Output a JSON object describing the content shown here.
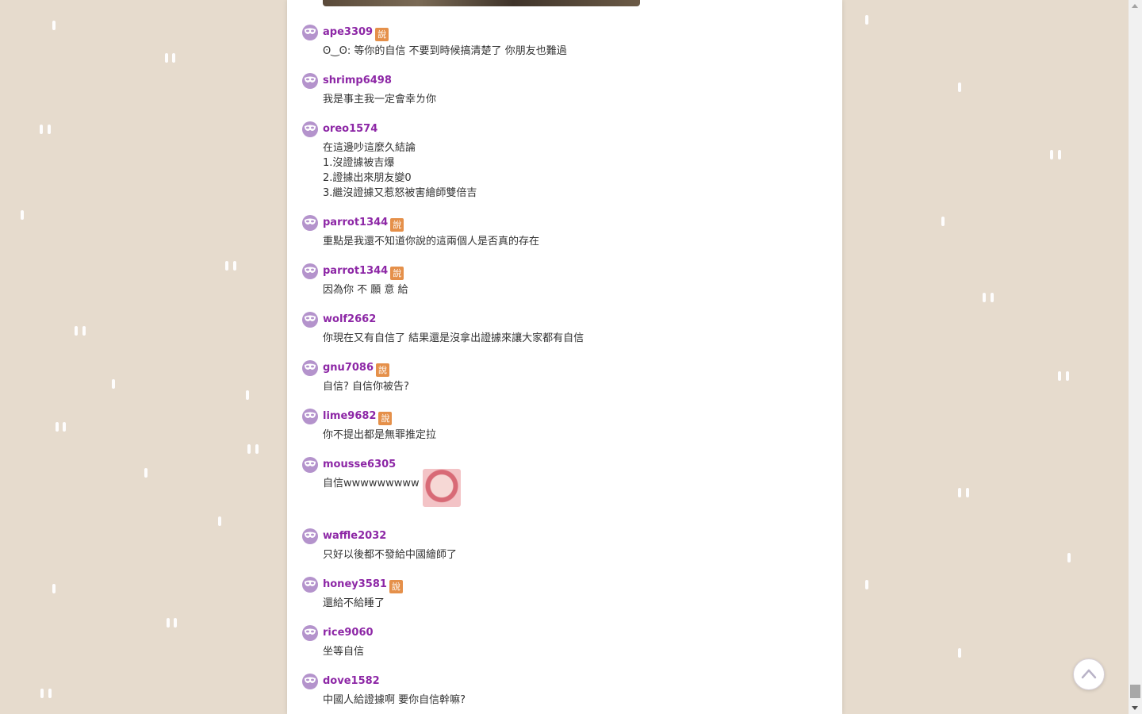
{
  "comments": [
    {
      "username": "ape3309",
      "badge": "說",
      "lines": [
        "ʘ‿ʘ: 等你的自信 不要到時候搞清楚了 你朋友也難過"
      ]
    },
    {
      "username": "shrimp6498",
      "badge": "",
      "lines": [
        "我是事主我一定會幸ㄌ你"
      ]
    },
    {
      "username": "oreo1574",
      "badge": "",
      "lines": [
        "在這邊吵這麼久結論",
        "1.沒證據被吉爆",
        "2.證據出來朋友變0",
        "3.繼沒證據又惹怒被害繪師雙倍吉"
      ]
    },
    {
      "username": "parrot1344",
      "badge": "說",
      "lines": [
        "重點是我還不知道你說的這兩個人是否真的存在"
      ]
    },
    {
      "username": "parrot1344",
      "badge": "說",
      "lines": [
        "因為你 不 願 意 給"
      ]
    },
    {
      "username": "wolf2662",
      "badge": "",
      "lines": [
        "你現在又有自信了 結果還是沒拿出證據來讓大家都有自信"
      ]
    },
    {
      "username": "gnu7086",
      "badge": "說",
      "lines": [
        "自信? 自信你被告?"
      ]
    },
    {
      "username": "lime9682",
      "badge": "說",
      "lines": [
        "你不提出都是無罪推定拉"
      ]
    },
    {
      "username": "mousse6305",
      "badge": "",
      "lines": [
        "自信wwwwwwwww"
      ],
      "sticker": "angry-face-sticker"
    },
    {
      "username": "waffle2032",
      "badge": "",
      "lines": [
        "只好以後都不發給中國繪師了"
      ]
    },
    {
      "username": "honey3581",
      "badge": "說",
      "lines": [
        "還給不給睡了"
      ]
    },
    {
      "username": "rice9060",
      "badge": "",
      "lines": [
        "坐等自信"
      ]
    },
    {
      "username": "dove1582",
      "badge": "",
      "lines": [
        "中國人給證據啊 要你自信幹嘛?"
      ]
    }
  ],
  "colors": {
    "background": "#e6dbcd",
    "username": "#8d27a6",
    "badge": "#e5904a",
    "avatar": "#b493cc"
  },
  "icons": {
    "avatar": "mask-icon",
    "scroll_top": "chevron-up-icon"
  }
}
